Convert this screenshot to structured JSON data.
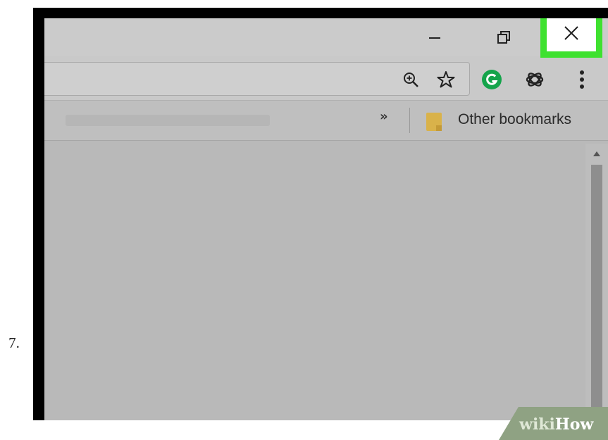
{
  "step": {
    "number": "7."
  },
  "window": {
    "controls": {
      "minimize_icon": "minimize-icon",
      "restore_icon": "restore-icon",
      "close_icon": "close-icon",
      "close_highlight_color": "#3ee12f"
    }
  },
  "toolbar": {
    "icons": [
      "zoom-in-icon",
      "star-icon",
      "grammarly-icon",
      "extension-icon",
      "menu-dots-icon"
    ],
    "grammarly_color": "#15a44b"
  },
  "bookmarks_bar": {
    "overflow": "»",
    "other_bookmarks_label": "Other bookmarks",
    "folder_color": "#d9b24a"
  },
  "watermark": {
    "part1": "wiki",
    "part2": "How"
  }
}
